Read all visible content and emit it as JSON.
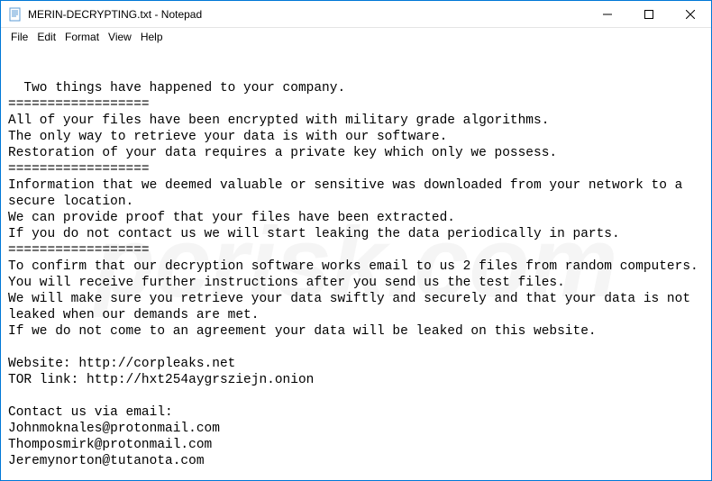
{
  "window": {
    "title": "MERIN-DECRYPTING.txt - Notepad"
  },
  "menubar": {
    "items": [
      "File",
      "Edit",
      "Format",
      "View",
      "Help"
    ]
  },
  "content": {
    "text": "Two things have happened to your company.\n==================\nAll of your files have been encrypted with military grade algorithms.\nThe only way to retrieve your data is with our software.\nRestoration of your data requires a private key which only we possess.\n==================\nInformation that we deemed valuable or sensitive was downloaded from your network to a secure location.\nWe can provide proof that your files have been extracted.\nIf you do not contact us we will start leaking the data periodically in parts.\n==================\nTo confirm that our decryption software works email to us 2 files from random computers.\nYou will receive further instructions after you send us the test files.\nWe will make sure you retrieve your data swiftly and securely and that your data is not leaked when our demands are met.\nIf we do not come to an agreement your data will be leaked on this website.\n\nWebsite: http://corpleaks.net\nTOR link: http://hxt254aygrsziejn.onion\n\nContact us via email:\nJohnmoknales@protonmail.com\nThomposmirk@protonmail.com\nJeremynorton@tutanota.com"
  },
  "watermark": {
    "text": "pcrisk.com"
  }
}
